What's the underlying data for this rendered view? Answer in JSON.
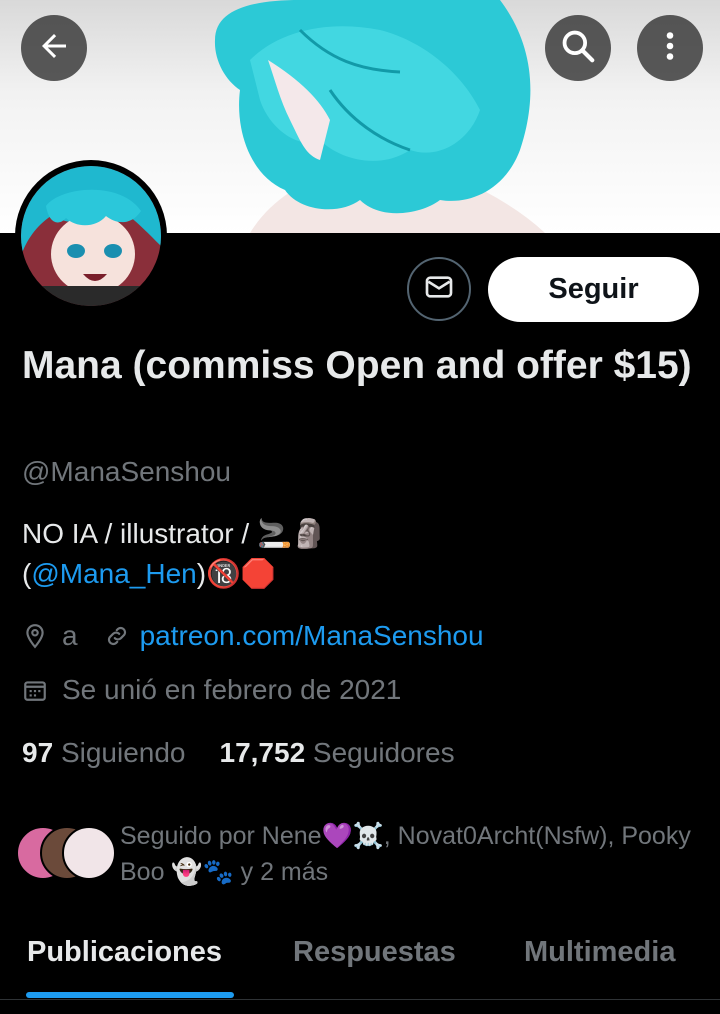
{
  "profile": {
    "name": "Mana (commiss Open and offer $15)",
    "handle": "@ManaSenshou",
    "bio_text": "NO IA / illustrator / 🚬🗿",
    "bio_link_prefix": "(",
    "bio_link": "@Mana_Hen",
    "bio_suffix": ")🔞🛑",
    "location": "a",
    "website": "patreon.com/ManaSenshou",
    "joined": "Se unió en febrero de 2021"
  },
  "actions": {
    "follow_label": "Seguir"
  },
  "stats": {
    "following_count": "97",
    "following_label": "Siguiendo",
    "followers_count": "17,752",
    "followers_label": "Seguidores"
  },
  "followed_by": {
    "text": "Seguido por Nene💜☠️, Novat0Archt(Nsfw), Pooky Boo 👻🐾 y 2 más"
  },
  "tabs": [
    {
      "label": "Publicaciones",
      "active": true
    },
    {
      "label": "Respuestas",
      "active": false
    },
    {
      "label": "Multimedia",
      "active": false
    }
  ],
  "colors": {
    "accent": "#1d9bf0",
    "background": "#000000",
    "muted_text": "#71767b"
  },
  "icons": {
    "back": "arrow-left-icon",
    "search": "search-icon",
    "more": "more-vertical-icon",
    "message": "envelope-icon",
    "location": "location-pin-icon",
    "link": "link-icon",
    "calendar": "calendar-icon"
  }
}
